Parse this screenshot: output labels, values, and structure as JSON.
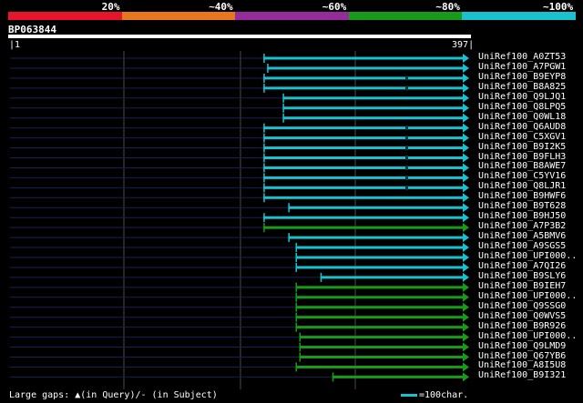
{
  "legend": [
    {
      "label": "20%",
      "color": "#e7142c"
    },
    {
      "label": "~40%",
      "color": "#e8761d"
    },
    {
      "label": "~60%",
      "color": "#962b9c"
    },
    {
      "label": "~80%",
      "color": "#199b1a"
    },
    {
      "label": "~100%",
      "color": "#19c1cf"
    }
  ],
  "query": {
    "id": "BP063844",
    "start": "1",
    "end": "397"
  },
  "hits": [
    {
      "name": "UniRef100_A0ZT53",
      "start": 0.552,
      "color": "cyan",
      "gap": false
    },
    {
      "name": "UniRef100_A7PGW1",
      "start": 0.56,
      "color": "cyan",
      "gap": false
    },
    {
      "name": "UniRef100_B9EYP8",
      "start": 0.552,
      "color": "cyan",
      "gap": true
    },
    {
      "name": "UniRef100_B8A825",
      "start": 0.552,
      "color": "cyan",
      "gap": true
    },
    {
      "name": "UniRef100_Q9LJQ1",
      "start": 0.594,
      "color": "cyan",
      "gap": false
    },
    {
      "name": "UniRef100_Q8LPQ5",
      "start": 0.594,
      "color": "cyan",
      "gap": false
    },
    {
      "name": "UniRef100_Q0WL18",
      "start": 0.594,
      "color": "cyan",
      "gap": false
    },
    {
      "name": "UniRef100_Q6AUD8",
      "start": 0.552,
      "color": "cyan",
      "gap": true
    },
    {
      "name": "UniRef100_C5XGV1",
      "start": 0.552,
      "color": "cyan",
      "gap": true
    },
    {
      "name": "UniRef100_B9I2K5",
      "start": 0.552,
      "color": "cyan",
      "gap": true
    },
    {
      "name": "UniRef100_B9FLH3",
      "start": 0.552,
      "color": "cyan",
      "gap": true
    },
    {
      "name": "UniRef100_B8AWE7",
      "start": 0.552,
      "color": "cyan",
      "gap": true
    },
    {
      "name": "UniRef100_C5YV16",
      "start": 0.552,
      "color": "cyan",
      "gap": true
    },
    {
      "name": "UniRef100_Q8LJR1",
      "start": 0.552,
      "color": "cyan",
      "gap": true
    },
    {
      "name": "UniRef100_B9HWF6",
      "start": 0.552,
      "color": "cyan",
      "gap": false
    },
    {
      "name": "UniRef100_B9T628",
      "start": 0.606,
      "color": "cyan",
      "gap": false
    },
    {
      "name": "UniRef100_B9HJ50",
      "start": 0.552,
      "color": "cyan",
      "gap": false
    },
    {
      "name": "UniRef100_A7P3B2",
      "start": 0.552,
      "color": "green",
      "gap": false
    },
    {
      "name": "UniRef100_A5BMV6",
      "start": 0.606,
      "color": "cyan",
      "gap": false
    },
    {
      "name": "UniRef100_A9SGS5",
      "start": 0.622,
      "color": "cyan",
      "gap": false
    },
    {
      "name": "UniRef100_UPI000..",
      "start": 0.622,
      "color": "cyan",
      "gap": false
    },
    {
      "name": "UniRef100_A7QI26",
      "start": 0.622,
      "color": "cyan",
      "gap": false
    },
    {
      "name": "UniRef100_B9SLY6",
      "start": 0.676,
      "color": "cyan",
      "gap": false
    },
    {
      "name": "UniRef100_B9IEH7",
      "start": 0.622,
      "color": "green",
      "gap": false
    },
    {
      "name": "UniRef100_UPI000..",
      "start": 0.622,
      "color": "green",
      "gap": false
    },
    {
      "name": "UniRef100_Q9SSG0",
      "start": 0.622,
      "color": "green",
      "gap": false
    },
    {
      "name": "UniRef100_Q0WVS5",
      "start": 0.622,
      "color": "green",
      "gap": false
    },
    {
      "name": "UniRef100_B9R926",
      "start": 0.622,
      "color": "green",
      "gap": false
    },
    {
      "name": "UniRef100_UPI000..",
      "start": 0.63,
      "color": "green",
      "gap": false
    },
    {
      "name": "UniRef100_Q9LMD9",
      "start": 0.63,
      "color": "green",
      "gap": false
    },
    {
      "name": "UniRef100_Q67YB6",
      "start": 0.63,
      "color": "green",
      "gap": false
    },
    {
      "name": "UniRef100_A8I5U8",
      "start": 0.622,
      "color": "green",
      "gap": false
    },
    {
      "name": "UniRef100_B9I321",
      "start": 0.702,
      "color": "green",
      "gap": false
    }
  ],
  "colors": {
    "cyan": "#19c1cf",
    "green": "#199b1a",
    "navy": "#1a1f58",
    "grid": "#4a4a4a"
  },
  "footer": {
    "gaps_text": "Large gaps: ▲(in Query)/- (in Subject)",
    "scale_text": "=100char."
  }
}
